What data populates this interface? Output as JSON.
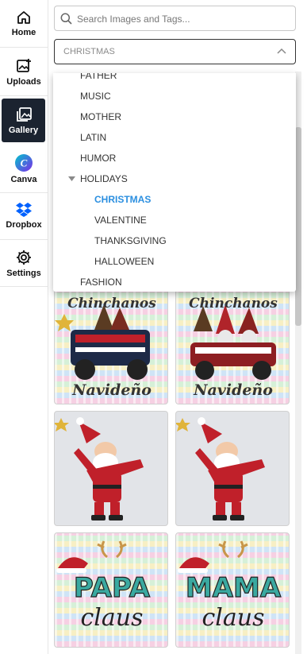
{
  "rail": {
    "items": [
      {
        "label": "Home",
        "icon": "home-icon"
      },
      {
        "label": "Uploads",
        "icon": "upload-image-icon"
      },
      {
        "label": "Gallery",
        "icon": "gallery-icon"
      },
      {
        "label": "Canva",
        "icon": "canva-icon"
      },
      {
        "label": "Dropbox",
        "icon": "dropbox-icon"
      },
      {
        "label": "Settings",
        "icon": "gear-icon"
      }
    ],
    "active": "Gallery"
  },
  "search": {
    "placeholder": "Search Images and Tags...",
    "value": ""
  },
  "category_select": {
    "value": "CHRISTMAS"
  },
  "dropdown": {
    "options": [
      {
        "label": "FATHER"
      },
      {
        "label": "MUSIC"
      },
      {
        "label": "MOTHER"
      },
      {
        "label": "LATIN"
      },
      {
        "label": "HUMOR"
      },
      {
        "label": "HOLIDAYS",
        "expanded": true
      },
      {
        "label": "CHRISTMAS",
        "selected": true
      },
      {
        "label": "VALENTINE"
      },
      {
        "label": "THANKSGIVING"
      },
      {
        "label": "HALLOWEEN"
      },
      {
        "label": "FASHION"
      }
    ]
  },
  "gallery": {
    "items": [
      {
        "art_text": [
          "Chinchanos",
          "Navideño"
        ]
      },
      {
        "art_text": [
          "Chinchanos",
          "Navideño"
        ]
      },
      {
        "art_text": []
      },
      {
        "art_text": []
      },
      {
        "art_text": [
          "PAPA",
          "claus"
        ]
      },
      {
        "art_text": [
          "MAMA",
          "claus"
        ]
      }
    ]
  },
  "colors": {
    "accent": "#2b8fe0",
    "rail_active_bg": "#1b2330",
    "canva_purple": "#7d2ae8",
    "dropbox_blue": "#0061fe"
  }
}
